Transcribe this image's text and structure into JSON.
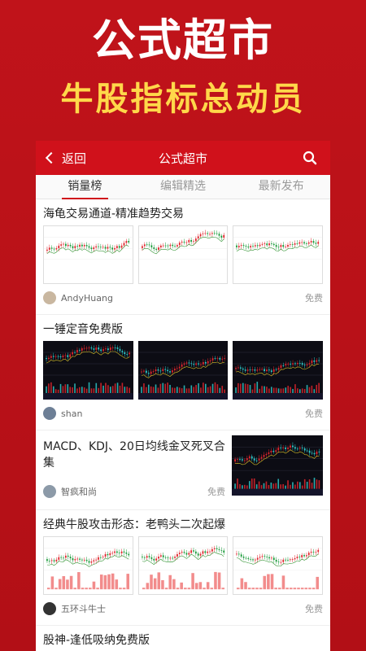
{
  "promo": {
    "title": "公式超市",
    "subtitle": "牛股指标总动员"
  },
  "navbar": {
    "back_label": "返回",
    "title": "公式超市"
  },
  "tabs": [
    {
      "label": "销量榜"
    },
    {
      "label": "编辑精选"
    },
    {
      "label": "最新发布"
    }
  ],
  "items": [
    {
      "title": "海龟交易通道-精准趋势交易",
      "author": "AndyHuang",
      "price": "免费"
    },
    {
      "title": "一锤定音免费版",
      "author": "shan",
      "price": "免费"
    },
    {
      "title": "MACD、KDJ、20日均线金叉死叉合集",
      "author": "智疯和尚",
      "price": "免费"
    },
    {
      "title": "经典牛股攻击形态：老鸭头二次起爆",
      "author": "五环斗牛士",
      "price": "免费"
    },
    {
      "title": "股神-逢低吸纳免费版"
    }
  ],
  "colors": {
    "brand": "#d0111b",
    "background": "#c0131a",
    "accent_yellow": "#ffd84a"
  },
  "icons": {
    "back": "chevron-left-icon",
    "search": "search-icon"
  }
}
